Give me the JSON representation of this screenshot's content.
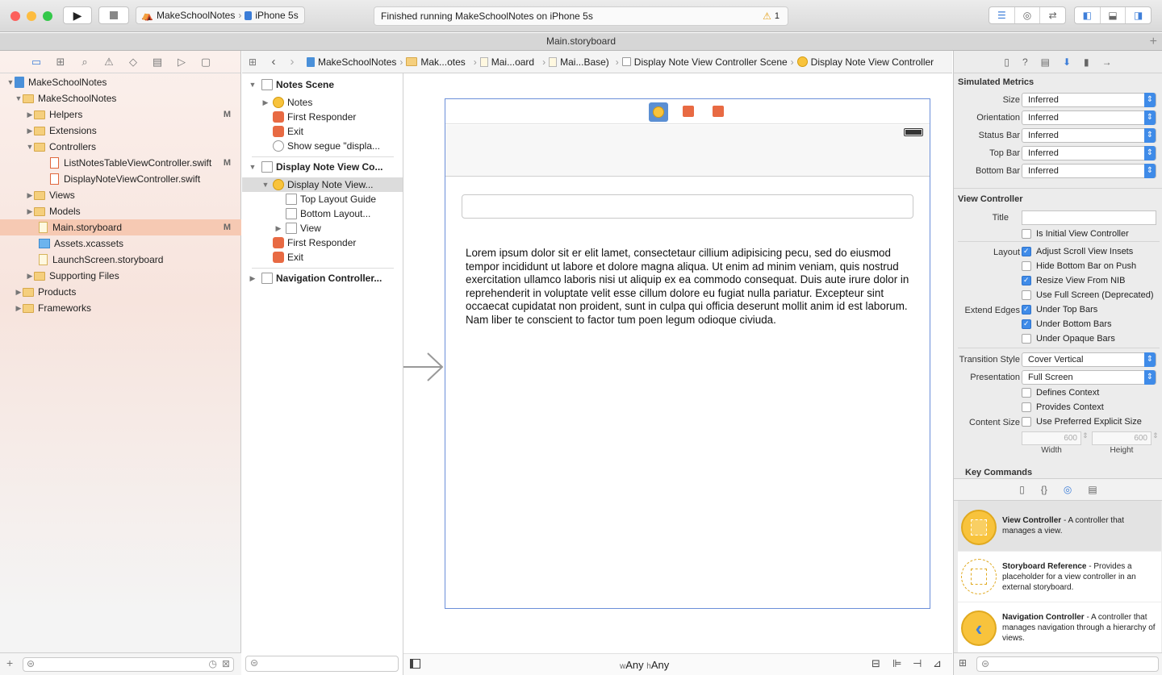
{
  "toolbar": {
    "scheme_app": "MakeSchoolNotes",
    "scheme_device": "iPhone 5s",
    "status_text": "Finished running MakeSchoolNotes on iPhone 5s",
    "warning_count": "1"
  },
  "tab": {
    "title": "Main.storyboard"
  },
  "navigator": {
    "items": [
      {
        "label": "MakeSchoolNotes",
        "badge": ""
      },
      {
        "label": "MakeSchoolNotes",
        "badge": ""
      },
      {
        "label": "Helpers",
        "badge": "M"
      },
      {
        "label": "Extensions",
        "badge": ""
      },
      {
        "label": "Controllers",
        "badge": ""
      },
      {
        "label": "ListNotesTableViewController.swift",
        "badge": "M"
      },
      {
        "label": "DisplayNoteViewController.swift",
        "badge": ""
      },
      {
        "label": "Views",
        "badge": ""
      },
      {
        "label": "Models",
        "badge": ""
      },
      {
        "label": "Main.storyboard",
        "badge": "M"
      },
      {
        "label": "Assets.xcassets",
        "badge": ""
      },
      {
        "label": "LaunchScreen.storyboard",
        "badge": ""
      },
      {
        "label": "Supporting Files",
        "badge": ""
      },
      {
        "label": "Products",
        "badge": ""
      },
      {
        "label": "Frameworks",
        "badge": ""
      }
    ]
  },
  "jumpbar": {
    "crumbs": [
      "MakeSchoolNotes",
      "Mak...otes",
      "Mai...oard",
      "Mai...Base)",
      "Display Note View Controller Scene",
      "Display Note View Controller"
    ]
  },
  "outline": {
    "notes_scene": "Notes Scene",
    "notes": "Notes",
    "first_responder_1": "First Responder",
    "exit_1": "Exit",
    "show_segue": "Show segue \"displa...",
    "display_scene": "Display Note View Co...",
    "display_vc": "Display Note View...",
    "top_layout": "Top Layout Guide",
    "bottom_layout": "Bottom Layout...",
    "view": "View",
    "first_responder_2": "First Responder",
    "exit_2": "Exit",
    "nav_controller": "Navigation Controller..."
  },
  "canvas": {
    "body_text": "Lorem ipsum dolor sit er elit lamet, consectetaur cillium adipisicing pecu, sed do eiusmod tempor incididunt ut labore et dolore magna aliqua. Ut enim ad minim veniam, quis nostrud exercitation ullamco laboris nisi ut aliquip ex ea commodo consequat. Duis aute irure dolor in reprehenderit in voluptate velit esse cillum dolore eu fugiat nulla pariatur. Excepteur sint occaecat cupidatat non proident, sunt in culpa qui officia deserunt mollit anim id est laborum. Nam liber te conscient to factor tum poen legum odioque civiuda.",
    "size_w_prefix": "w",
    "size_w": "Any",
    "size_h_prefix": "h",
    "size_h": "Any"
  },
  "inspector": {
    "simulated_metrics": "Simulated Metrics",
    "size_label": "Size",
    "size_value": "Inferred",
    "orientation_label": "Orientation",
    "orientation_value": "Inferred",
    "status_bar_label": "Status Bar",
    "status_bar_value": "Inferred",
    "top_bar_label": "Top Bar",
    "top_bar_value": "Inferred",
    "bottom_bar_label": "Bottom Bar",
    "bottom_bar_value": "Inferred",
    "view_controller": "View Controller",
    "title_label": "Title",
    "is_initial": "Is Initial View Controller",
    "layout_label": "Layout",
    "adjust_scroll": "Adjust Scroll View Insets",
    "hide_bottom": "Hide Bottom Bar on Push",
    "resize_nib": "Resize View From NIB",
    "full_screen": "Use Full Screen (Deprecated)",
    "extend_edges": "Extend Edges",
    "under_top": "Under Top Bars",
    "under_bottom": "Under Bottom Bars",
    "under_opaque": "Under Opaque Bars",
    "transition_label": "Transition Style",
    "transition_value": "Cover Vertical",
    "presentation_label": "Presentation",
    "presentation_value": "Full Screen",
    "defines_context": "Defines Context",
    "provides_context": "Provides Context",
    "content_size_label": "Content Size",
    "preferred_size": "Use Preferred Explicit Size",
    "width_value": "600",
    "height_value": "600",
    "width_label": "Width",
    "height_label": "Height",
    "key_commands": "Key Commands"
  },
  "library": [
    {
      "title": "View Controller",
      "desc": " - A controller that manages a view."
    },
    {
      "title": "Storyboard Reference",
      "desc": " - Provides a placeholder for a view controller in an external storyboard."
    },
    {
      "title": "Navigation Controller",
      "desc": " - A controller that manages navigation through a hierarchy of views."
    }
  ]
}
